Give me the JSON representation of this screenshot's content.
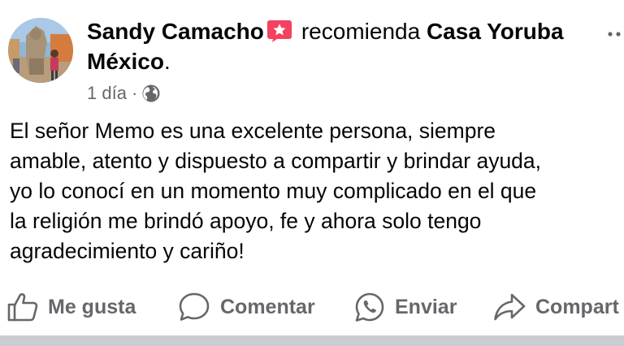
{
  "post": {
    "author_name": "Sandy Camacho",
    "verb": "recomienda",
    "page_name": "Casa Yoruba México",
    "period": ".",
    "time_ago": "1 día",
    "separator": "·",
    "privacy_icon": "globe-icon",
    "body": "El señor Memo es una excelente persona, siempre\namable, atento y dispuesto a compartir y brindar ayuda,\nyo lo conocí en un momento muy complicado en el que\nla religión me brindó apoyo, fe y ahora solo tengo\nagradecimiento y cariño!"
  },
  "actions": [
    {
      "label": "Me gusta",
      "icon": "thumbs-up-icon"
    },
    {
      "label": "Comentar",
      "icon": "comment-icon"
    },
    {
      "label": "Enviar",
      "icon": "whatsapp-icon"
    },
    {
      "label": "Compart",
      "icon": "share-icon"
    }
  ],
  "colors": {
    "text": "#050505",
    "secondary": "#65676b",
    "recommend_badge": "#f3425f",
    "divider": "#c9ccd1"
  }
}
